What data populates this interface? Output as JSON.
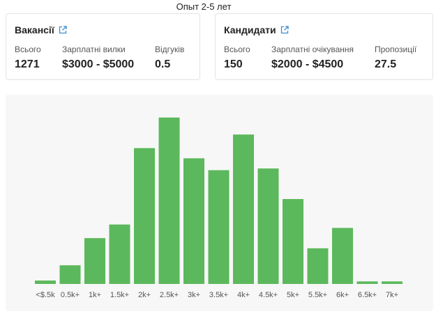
{
  "page": {
    "title": "Опыт 2-5 лет"
  },
  "vacancies": {
    "title": "Вакансії",
    "link_icon": "external-link-icon",
    "stats": [
      {
        "label": "Всього",
        "value": "1271"
      },
      {
        "label": "Зарплатні вилки",
        "value": "$3000 - $5000"
      },
      {
        "label": "Відгуків",
        "value": "0.5"
      }
    ]
  },
  "candidates": {
    "title": "Кандидати",
    "link_icon": "external-link-icon",
    "stats": [
      {
        "label": "Всього",
        "value": "150"
      },
      {
        "label": "Зарплатні очікування",
        "value": "$2000 - $4500"
      },
      {
        "label": "Пропозиції",
        "value": "27.5"
      }
    ]
  },
  "colors": {
    "bar": "#5cb85c",
    "link": "#3a8fd1",
    "panel": "#f7f7f7"
  },
  "chart_data": {
    "type": "bar",
    "categories": [
      "<$.5k",
      "0.5k+",
      "1k+",
      "1.5k+",
      "2k+",
      "2.5k+",
      "3k+",
      "3.5k+",
      "4k+",
      "4.5k+",
      "5k+",
      "5.5k+",
      "6k+",
      "6.5k+",
      "7k+"
    ],
    "values": [
      2,
      11,
      27,
      35,
      80,
      98,
      74,
      67,
      88,
      68,
      50,
      21,
      33,
      1.5,
      1.5
    ],
    "ylim": [
      0,
      100
    ],
    "grid": false,
    "legend": "none"
  }
}
